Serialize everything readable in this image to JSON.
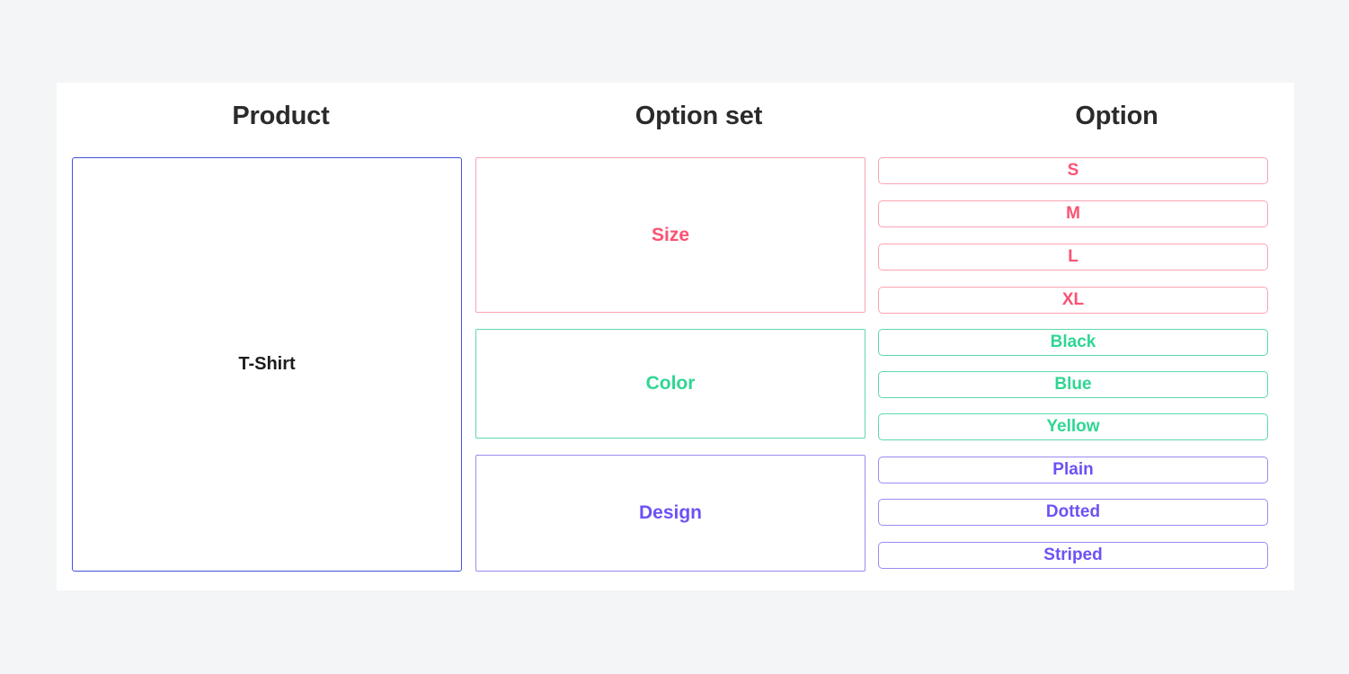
{
  "page": {
    "background_color": "#f4f5f7",
    "card_color": "#ffffff"
  },
  "palette": {
    "product_blue": "#4350dc",
    "size_pink_text": "#fa5273",
    "size_pink_border": "#f9a3b4",
    "color_green_text": "#2fd693",
    "color_green_border": "#5dd9a8",
    "design_purple_text": "#6c52f5",
    "design_purple_border": "#9b8bf2",
    "header_text": "#2b2b2b",
    "product_text": "#1c1c1c"
  },
  "columns": {
    "product": {
      "header": "Product"
    },
    "option_set": {
      "header": "Option set"
    },
    "option": {
      "header": "Option"
    }
  },
  "product": {
    "name": "T-Shirt"
  },
  "option_sets": [
    {
      "name": "Size",
      "text_color": "#fa5273",
      "border_color": "#f9a3b4",
      "options": [
        {
          "label": "S"
        },
        {
          "label": "M"
        },
        {
          "label": "L"
        },
        {
          "label": "XL"
        }
      ]
    },
    {
      "name": "Color",
      "text_color": "#2fd693",
      "border_color": "#5dd9a8",
      "options": [
        {
          "label": "Black"
        },
        {
          "label": "Blue"
        },
        {
          "label": "Yellow"
        }
      ]
    },
    {
      "name": "Design",
      "text_color": "#6c52f5",
      "border_color": "#9b8bf2",
      "options": [
        {
          "label": "Plain"
        },
        {
          "label": "Dotted"
        },
        {
          "label": "Striped"
        }
      ]
    }
  ],
  "layout": {
    "option_pill_tops": [
      83,
      131,
      179,
      227,
      274,
      321,
      368,
      416,
      463,
      511
    ]
  }
}
